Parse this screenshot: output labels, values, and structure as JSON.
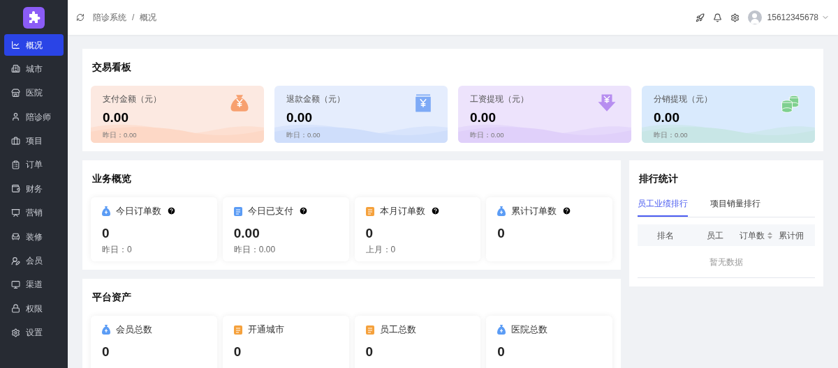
{
  "sidebar": {
    "items": [
      {
        "label": "概况",
        "selected": true
      },
      {
        "label": "城市",
        "selected": false
      },
      {
        "label": "医院",
        "selected": false
      },
      {
        "label": "陪诊师",
        "selected": false
      },
      {
        "label": "项目",
        "selected": false
      },
      {
        "label": "订单",
        "selected": false
      },
      {
        "label": "财务",
        "selected": false
      },
      {
        "label": "营销",
        "selected": false
      },
      {
        "label": "装修",
        "selected": false
      },
      {
        "label": "会员",
        "selected": false
      },
      {
        "label": "渠道",
        "selected": false
      },
      {
        "label": "权限",
        "selected": false
      },
      {
        "label": "设置",
        "selected": false
      }
    ]
  },
  "header": {
    "breadcrumb": [
      "陪诊系统",
      "概况"
    ],
    "separator": "/",
    "user": "15612345678"
  },
  "trade_board": {
    "title": "交易看板",
    "cards": [
      {
        "label": "支付金额（元）",
        "value": "0.00",
        "sub": "昨日：0.00"
      },
      {
        "label": "退款金额（元）",
        "value": "0.00",
        "sub": "昨日：0.00"
      },
      {
        "label": "工资提现（元）",
        "value": "0.00",
        "sub": "昨日：0.00"
      },
      {
        "label": "分销提现（元）",
        "value": "0.00",
        "sub": "昨日：0.00"
      }
    ]
  },
  "business": {
    "title": "业务概览",
    "cards": [
      {
        "label": "今日订单数",
        "help": true,
        "value": "0",
        "sub": "昨日：0"
      },
      {
        "label": "今日已支付",
        "help": true,
        "value": "0.00",
        "sub": "昨日：0.00"
      },
      {
        "label": "本月订单数",
        "help": true,
        "value": "0",
        "sub": "上月：0"
      },
      {
        "label": "累计订单数",
        "help": true,
        "value": "0"
      }
    ]
  },
  "assets": {
    "title": "平台资产",
    "cards": [
      {
        "label": "会员总数",
        "value": "0"
      },
      {
        "label": "开通城市",
        "value": "0"
      },
      {
        "label": "员工总数",
        "value": "0"
      },
      {
        "label": "医院总数",
        "value": "0"
      }
    ]
  },
  "ranking": {
    "title": "排行统计",
    "tabs": [
      {
        "label": "员工业绩排行",
        "selected": true
      },
      {
        "label": "项目销量排行",
        "selected": false
      }
    ],
    "table": {
      "columns": [
        {
          "label": "排名",
          "sortable": false
        },
        {
          "label": "员工",
          "sortable": false
        },
        {
          "label": "订单数",
          "sortable": true
        },
        {
          "label": "累计佣",
          "sortable": false
        }
      ],
      "empty": "暂无数据"
    }
  }
}
